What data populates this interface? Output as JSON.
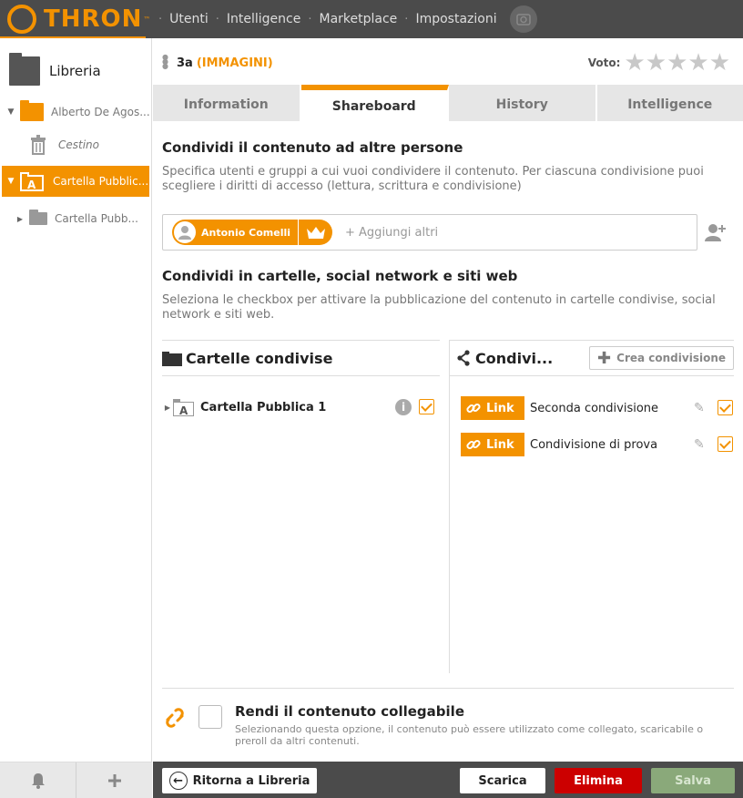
{
  "brand": {
    "name": "THRON",
    "tm": "™",
    "accent": "#f39200"
  },
  "topnav": {
    "items": [
      "Utenti",
      "Intelligence",
      "Marketplace",
      "Impostazioni"
    ],
    "separator": "·"
  },
  "sidebar": {
    "title": "Libreria",
    "tree": [
      {
        "label": "Alberto De Agos...",
        "type": "folder"
      },
      {
        "label": "Cestino",
        "type": "trash"
      },
      {
        "label": "Cartella Pubblic...",
        "type": "public-folder",
        "active": true
      },
      {
        "label": "Cartella Pubb...",
        "type": "subfolder"
      }
    ]
  },
  "asset": {
    "name": "3a",
    "type": "(IMMAGINI)",
    "vote_label": "Voto:",
    "rating": 0,
    "max_rating": 5
  },
  "tabs": [
    {
      "label": "Information",
      "active": false
    },
    {
      "label": "Shareboard",
      "active": true
    },
    {
      "label": "History",
      "active": false
    },
    {
      "label": "Intelligence",
      "active": false
    }
  ],
  "share_people": {
    "title": "Condividi il contenuto ad altre persone",
    "description": "Specifica utenti e gruppi a cui vuoi condividere il contenuto. Per ciascuna condivisione puoi scegliere i diritti di accesso (lettura, scrittura e condivisione)",
    "user_chip": "Antonio Comelli",
    "add_placeholder": "+ Aggiungi altri"
  },
  "share_folders": {
    "title": "Condividi in cartelle, social network e siti web",
    "description": "Seleziona le checkbox per attivare la pubblicazione del contenuto in cartelle condivise, social network e siti web.",
    "folders_header": "Cartelle condivise",
    "folders": [
      {
        "name": "Cartella Pubblica 1",
        "checked": true
      }
    ],
    "shares_header": "Condivi...",
    "create_label": "Crea condivisione",
    "shares": [
      {
        "badge": "Link",
        "name": "Seconda condivisione",
        "checked": true
      },
      {
        "badge": "Link",
        "name": "Condivisione di prova",
        "checked": true
      }
    ]
  },
  "linkable": {
    "title": "Rendi il contenuto collegabile",
    "description": "Selezionando questa opzione, il contenuto può essere utilizzato come collegato, scaricabile o preroll da altri contenuti.",
    "checked": false
  },
  "footer": {
    "back": "Ritorna a Libreria",
    "download": "Scarica",
    "delete": "Elimina",
    "save": "Salva"
  }
}
